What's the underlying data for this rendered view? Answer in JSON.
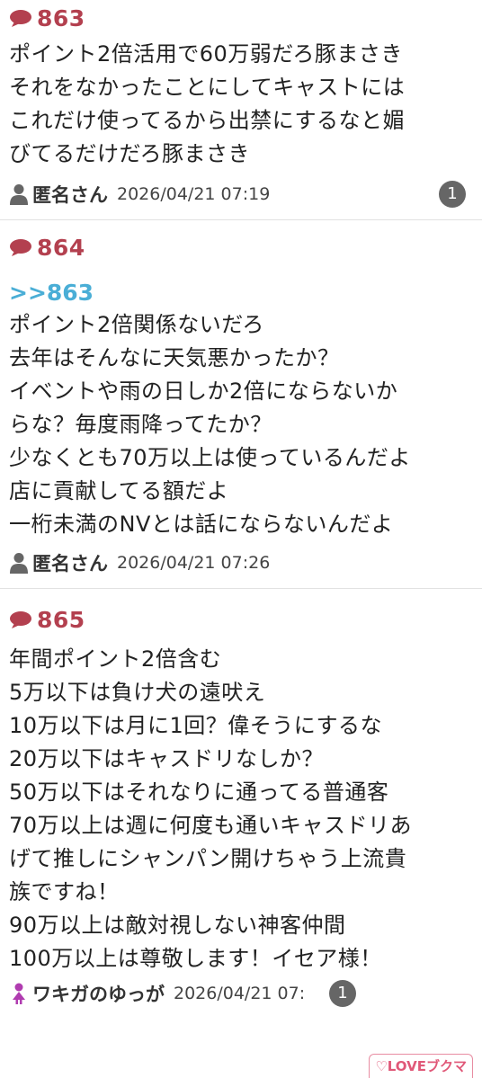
{
  "posts": [
    {
      "number": "863",
      "anchor": "",
      "lines": [
        "ポイント2倍活用で60万弱だろ豚まさき",
        "それをなかったことにしてキャストには",
        "これだけ使ってるから出禁にするなと媚",
        "びてるだけだろ豚まさき"
      ],
      "author": "匿名さん",
      "date": "2026/04/21 07:19",
      "reply_count": "1"
    },
    {
      "number": "864",
      "anchor": ">>863",
      "lines": [
        "ポイント2倍関係ないだろ",
        "去年はそんなに天気悪かったか？",
        "イベントや雨の日しか2倍にならないか",
        "らな？毎度雨降ってたか？",
        "少なくとも70万以上は使っているんだよ",
        "店に貢献してる額だよ",
        "一桁未満のNVとは話にならないんだよ"
      ],
      "author": "匿名さん",
      "date": "2026/04/21 07:26",
      "reply_count": ""
    },
    {
      "number": "865",
      "anchor": "",
      "lines": [
        "年間ポイント2倍含む",
        "5万以下は負け犬の遠吠え",
        "10万以下は月に1回？偉そうにするな",
        "20万以下はキャスドリなしか？",
        "50万以下はそれなりに通ってる普通客",
        "70万以上は週に何度も通いキャスドリあ",
        "げて推しにシャンパン開けちゃう上流貴",
        "族ですね！",
        "90万以上は敵対視しない神客仲間",
        "100万以上は尊敬します！イセア様！"
      ],
      "author": "ワキガのゆっが",
      "date": "2026/04/21 07:",
      "reply_count": "1"
    }
  ],
  "love_button": "LOVEブクマ",
  "colors": {
    "number": "#b3404f",
    "anchor": "#4aaed6",
    "badge": "#666666",
    "female_icon": "#b03cb0",
    "love": "#e05878"
  },
  "icons": {
    "number": "speech-bubble-icon",
    "anon_author": "person-icon",
    "named_author": "female-icon"
  }
}
